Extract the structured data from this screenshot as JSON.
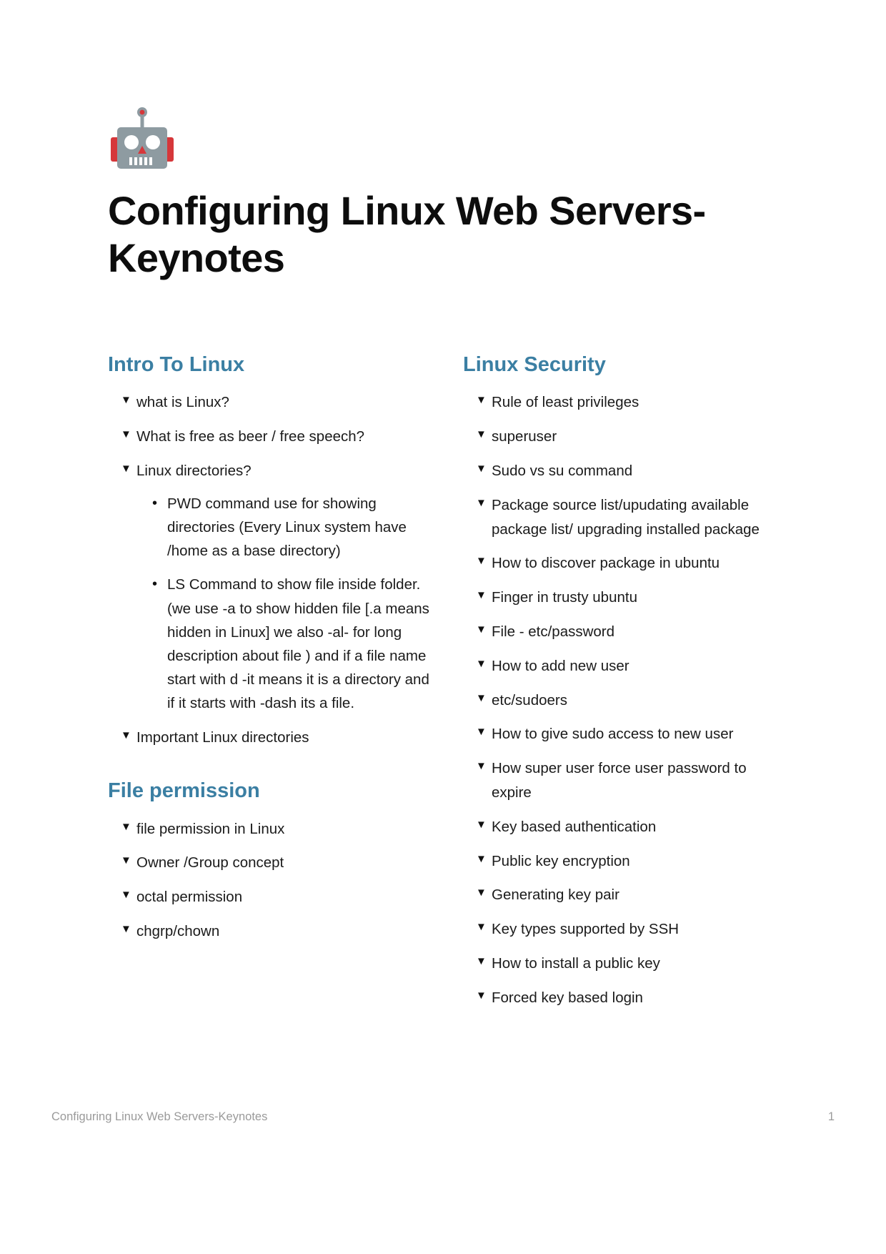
{
  "document": {
    "title": "Configuring Linux Web Servers-Keynotes",
    "icon": "robot-icon"
  },
  "colors": {
    "heading_blue": "#3b7fa3",
    "title_black": "#0d0d0d",
    "footer_gray": "#9a9a9a",
    "robot_body": "#8e9ba1",
    "robot_accent": "#d6373a"
  },
  "bullets": {
    "triangle": "▼",
    "dot": "•"
  },
  "columns": {
    "left": [
      {
        "heading": "Intro To Linux",
        "items": [
          {
            "text": "what is Linux?"
          },
          {
            "text": "What is free as beer / free speech?"
          },
          {
            "text": "Linux directories?",
            "sub": [
              "PWD command use for showing directories (Every Linux system have /home as a base directory)",
              "LS Command to show file inside folder. (we use -a to show hidden file [.a means hidden in Linux] we also -al- for long description about file ) and if a file name start with d -it means it is a directory and if it starts with -dash  its a file."
            ]
          },
          {
            "text": "Important Linux directories"
          }
        ]
      },
      {
        "heading": "File permission",
        "items": [
          {
            "text": "file permission in Linux"
          },
          {
            "text": "Owner /Group concept"
          },
          {
            "text": "octal permission"
          },
          {
            "text": "chgrp/chown"
          }
        ]
      }
    ],
    "right": [
      {
        "heading": "Linux Security",
        "items": [
          {
            "text": "Rule of least privileges"
          },
          {
            "text": "superuser"
          },
          {
            "text": "Sudo vs su command"
          },
          {
            "text": "Package source list/upudating available package list/ upgrading installed package"
          },
          {
            "text": "How to discover package in ubuntu"
          },
          {
            "text": "Finger in trusty ubuntu"
          },
          {
            "text": "File - etc/password"
          },
          {
            "text": "How to add new user"
          },
          {
            "text": "etc/sudoers"
          },
          {
            "text": "How to give sudo access to new user"
          },
          {
            "text": "How super user force user password to expire"
          },
          {
            "text": "Key based authentication"
          },
          {
            "text": "Public key encryption"
          },
          {
            "text": "Generating key pair"
          },
          {
            "text": "Key types supported by SSH"
          },
          {
            "text": "How to install a public key"
          },
          {
            "text": "Forced key based login"
          }
        ]
      }
    ]
  },
  "footer": {
    "left": "Configuring Linux Web Servers-Keynotes",
    "page_number": "1"
  }
}
